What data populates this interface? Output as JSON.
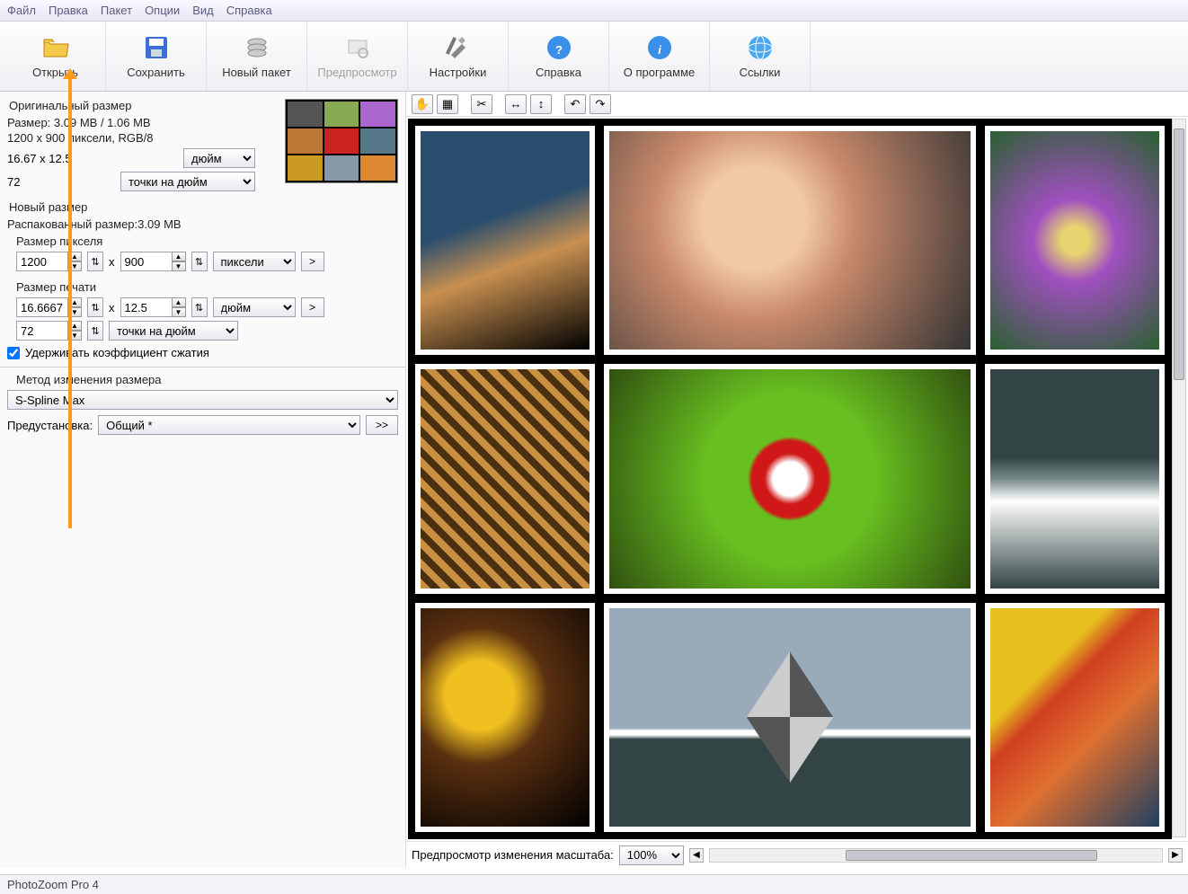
{
  "menu": {
    "file": "Файл",
    "edit": "Правка",
    "batch": "Пакет",
    "options": "Опции",
    "view": "Вид",
    "help": "Справка"
  },
  "toolbar": {
    "open": "Открыть",
    "save": "Сохранить",
    "newbatch": "Новый пакет",
    "preview": "Предпросмотр",
    "settings": "Настройки",
    "help": "Справка",
    "about": "О программе",
    "links": "Ссылки"
  },
  "orig": {
    "title": "Оригинальный размер",
    "size_label": "Размер:",
    "size_value": "3.09 MB / 1.06 MB",
    "dims": "1200 x 900 пиксели, RGB/8",
    "phys": "16.67 x 12.5",
    "unit1": "дюйм",
    "res": "72",
    "unit2": "точки на дюйм"
  },
  "newsize": {
    "title": "Новый размер",
    "unpacked_label": "Распакованный размер:",
    "unpacked_value": "3.09 MB",
    "pixel_title": "Размер пикселя",
    "w": "1200",
    "h": "900",
    "x": "x",
    "unit": "пиксели",
    "print_title": "Размер печати",
    "pw": "16.6667",
    "ph": "12.5",
    "punit": "дюйм",
    "res": "72",
    "resunit": "точки на дюйм",
    "keep_ratio": "Удерживать коэффициент сжатия"
  },
  "method": {
    "title": "Метод изменения размера",
    "algo": "S-Spline Max",
    "preset_label": "Предустановка:",
    "preset": "Общий *",
    "more": ">>"
  },
  "preview": {
    "zoom_label": "Предпросмотр изменения масштаба:",
    "zoom": "100%"
  },
  "status": {
    "app": "PhotoZoom Pro 4"
  },
  "arrow": ">"
}
